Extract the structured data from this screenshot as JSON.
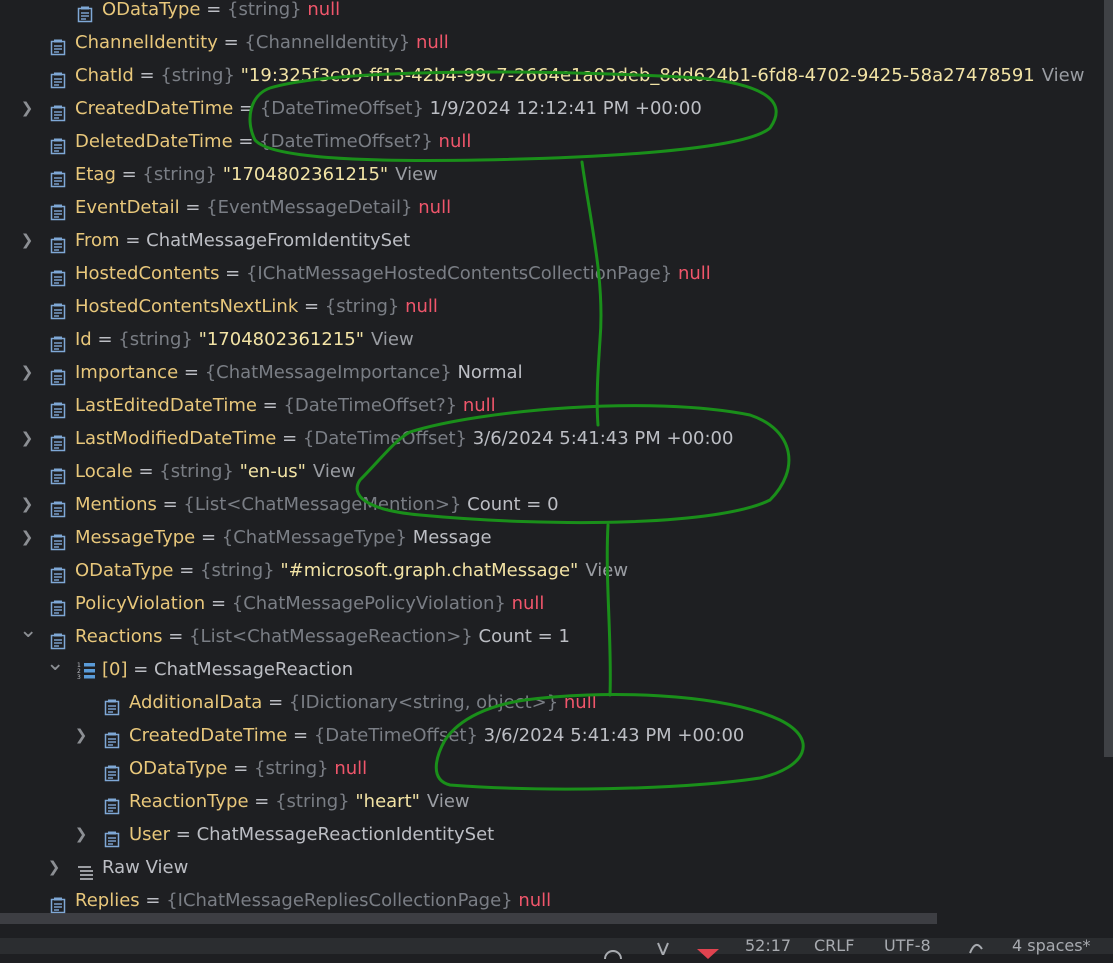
{
  "tree": {
    "rows": [
      {
        "level": 1,
        "name": "ODataType",
        "type": "{string}",
        "value": "null",
        "kind": "null",
        "icon": "field-icon",
        "expand": "none",
        "eq": "="
      },
      {
        "level": 0,
        "name": "ChannelIdentity",
        "type": "{ChannelIdentity}",
        "value": "null",
        "kind": "null",
        "icon": "field-icon",
        "expand": "none",
        "eq": "="
      },
      {
        "level": 0,
        "name": "ChatId",
        "type": "{string}",
        "value": "\"19:325f3c99-ff13-42b4-99c7-2664e1a03deb_8dd624b1-6fd8-4702-9425-58a27478591",
        "kind": "string",
        "link": "View",
        "icon": "field-icon",
        "expand": "none",
        "eq": "="
      },
      {
        "level": 0,
        "name": "CreatedDateTime",
        "type": "{DateTimeOffset}",
        "value": "1/9/2024 12:12:41 PM +00:00",
        "kind": "value",
        "icon": "field-icon",
        "expand": "collapsed",
        "eq": "="
      },
      {
        "level": 0,
        "name": "DeletedDateTime",
        "type": "{DateTimeOffset?}",
        "value": "null",
        "kind": "null",
        "icon": "field-icon",
        "expand": "none",
        "eq": "="
      },
      {
        "level": 0,
        "name": "Etag",
        "type": "{string}",
        "value": "\"1704802361215\"",
        "kind": "string",
        "link": "View",
        "icon": "field-icon",
        "expand": "none",
        "eq": "="
      },
      {
        "level": 0,
        "name": "EventDetail",
        "type": "{EventMessageDetail}",
        "value": "null",
        "kind": "null",
        "icon": "field-icon",
        "expand": "none",
        "eq": "="
      },
      {
        "level": 0,
        "name": "From",
        "type": "",
        "value": "ChatMessageFromIdentitySet",
        "kind": "value",
        "icon": "field-icon",
        "expand": "collapsed",
        "eq": "="
      },
      {
        "level": 0,
        "name": "HostedContents",
        "type": "{IChatMessageHostedContentsCollectionPage}",
        "value": "null",
        "kind": "null",
        "icon": "field-icon",
        "expand": "none",
        "eq": "="
      },
      {
        "level": 0,
        "name": "HostedContentsNextLink",
        "type": "{string}",
        "value": "null",
        "kind": "null",
        "icon": "field-icon",
        "expand": "none",
        "eq": "="
      },
      {
        "level": 0,
        "name": "Id",
        "type": "{string}",
        "value": "\"1704802361215\"",
        "kind": "string",
        "link": "View",
        "icon": "field-icon",
        "expand": "none",
        "eq": "="
      },
      {
        "level": 0,
        "name": "Importance",
        "type": "{ChatMessageImportance}",
        "value": "Normal",
        "kind": "value",
        "icon": "field-icon",
        "expand": "collapsed",
        "eq": "="
      },
      {
        "level": 0,
        "name": "LastEditedDateTime",
        "type": "{DateTimeOffset?}",
        "value": "null",
        "kind": "null",
        "icon": "field-icon",
        "expand": "none",
        "eq": "="
      },
      {
        "level": 0,
        "name": "LastModifiedDateTime",
        "type": "{DateTimeOffset}",
        "value": "3/6/2024 5:41:43 PM +00:00",
        "kind": "value",
        "icon": "field-icon",
        "expand": "collapsed",
        "eq": "="
      },
      {
        "level": 0,
        "name": "Locale",
        "type": "{string}",
        "value": "\"en-us\"",
        "kind": "string",
        "link": "View",
        "icon": "field-icon",
        "expand": "none",
        "eq": "="
      },
      {
        "level": 0,
        "name": "Mentions",
        "type": "{List<ChatMessageMention>}",
        "value": "Count = 0",
        "kind": "value",
        "icon": "field-icon",
        "expand": "collapsed",
        "eq": "="
      },
      {
        "level": 0,
        "name": "MessageType",
        "type": "{ChatMessageType}",
        "value": "Message",
        "kind": "value",
        "icon": "field-icon",
        "expand": "collapsed",
        "eq": "="
      },
      {
        "level": 0,
        "name": "ODataType",
        "type": "{string}",
        "value": "\"#microsoft.graph.chatMessage\"",
        "kind": "string",
        "link": "View",
        "icon": "field-icon",
        "expand": "none",
        "eq": "="
      },
      {
        "level": 0,
        "name": "PolicyViolation",
        "type": "{ChatMessagePolicyViolation}",
        "value": "null",
        "kind": "null",
        "icon": "field-icon",
        "expand": "none",
        "eq": "="
      },
      {
        "level": 0,
        "name": "Reactions",
        "type": "{List<ChatMessageReaction>}",
        "value": "Count = 1",
        "kind": "value",
        "icon": "field-icon",
        "expand": "expanded",
        "eq": "="
      },
      {
        "level": 1,
        "name": "[0]",
        "type": "",
        "value": "ChatMessageReaction",
        "kind": "value",
        "icon": "array-item-icon",
        "expand": "expanded",
        "eq": "="
      },
      {
        "level": 2,
        "name": "AdditionalData",
        "type": "{IDictionary<string, object>}",
        "value": "null",
        "kind": "null",
        "icon": "field-icon",
        "expand": "none",
        "eq": "="
      },
      {
        "level": 2,
        "name": "CreatedDateTime",
        "type": "{DateTimeOffset}",
        "value": "3/6/2024 5:41:43 PM +00:00",
        "kind": "value",
        "icon": "field-icon",
        "expand": "collapsed",
        "eq": "="
      },
      {
        "level": 2,
        "name": "ODataType",
        "type": "{string}",
        "value": "null",
        "kind": "null",
        "icon": "field-icon",
        "expand": "none",
        "eq": "="
      },
      {
        "level": 2,
        "name": "ReactionType",
        "type": "{string}",
        "value": "\"heart\"",
        "kind": "string",
        "link": "View",
        "icon": "field-icon",
        "expand": "none",
        "eq": "="
      },
      {
        "level": 2,
        "name": "User",
        "type": "",
        "value": "ChatMessageReactionIdentitySet",
        "kind": "value",
        "icon": "field-icon",
        "expand": "collapsed",
        "eq": "="
      },
      {
        "level": 1,
        "name": "Raw View",
        "type": "",
        "value": "",
        "kind": "value",
        "icon": "raw-view-icon",
        "expand": "collapsed",
        "eq": ""
      },
      {
        "level": 0,
        "name": "Replies",
        "type": "{IChatMessageRepliesCollectionPage}",
        "value": "null",
        "kind": "null",
        "icon": "field-icon",
        "expand": "none",
        "eq": "="
      }
    ]
  },
  "status_bar": {
    "position": "52:17",
    "line_ending": "CRLF",
    "encoding": "UTF-8",
    "indent": "4 spaces*"
  },
  "colors": {
    "annotation": "#1a8f1a",
    "name": "#e8c77b",
    "null": "#f0566b",
    "string": "#f2e3a5",
    "type": "#7a7e85"
  }
}
